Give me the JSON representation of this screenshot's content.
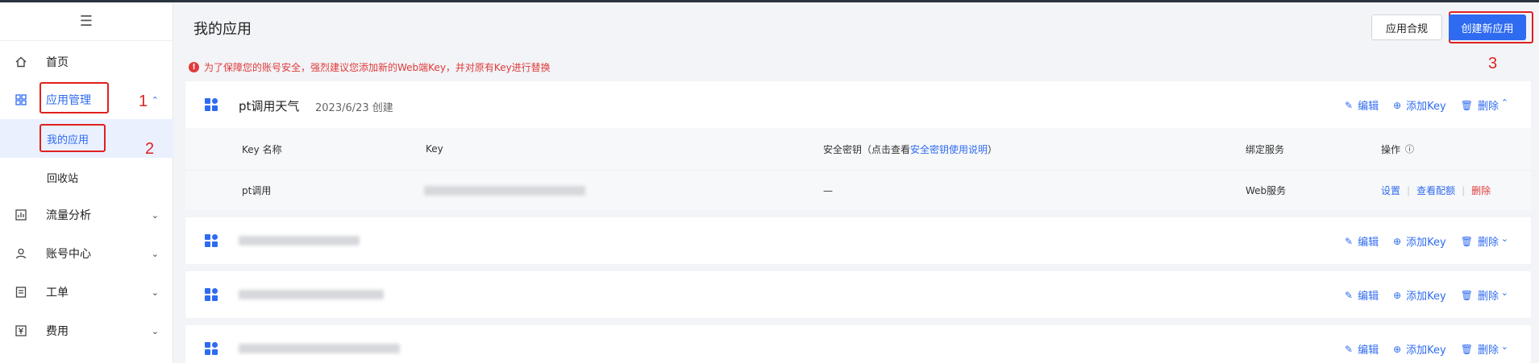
{
  "sidebar": {
    "menu_icon": "hamburger-icon",
    "items": [
      {
        "label": "首页",
        "icon": "home-icon"
      },
      {
        "label": "应用管理",
        "icon": "grid-icon"
      },
      {
        "label": "流量分析",
        "icon": "chart-icon"
      },
      {
        "label": "账号中心",
        "icon": "user-icon"
      },
      {
        "label": "工单",
        "icon": "ticket-icon"
      },
      {
        "label": "费用",
        "icon": "yen-icon"
      }
    ],
    "sub_items": [
      {
        "label": "我的应用"
      },
      {
        "label": "回收站"
      }
    ]
  },
  "annotations": {
    "n1": "1",
    "n2": "2",
    "n3": "3"
  },
  "header": {
    "title": "我的应用",
    "compliance_button": "应用合规",
    "create_button": "创建新应用"
  },
  "warning": {
    "text": "为了保障您的账号安全，强烈建议您添加新的Web端Key，并对原有Key进行替换"
  },
  "actions": {
    "edit": "编辑",
    "add_key": "添加Key",
    "delete": "删除"
  },
  "apps": [
    {
      "name": "pt调用天气",
      "date": "2023/6/23 创建"
    }
  ],
  "table": {
    "headers": {
      "key_name": "Key 名称",
      "key": "Key",
      "secret_prefix": "安全密钥（点击查看",
      "secret_link": "安全密钥使用说明",
      "secret_suffix": "）",
      "service": "绑定服务",
      "ops": "操作"
    },
    "rows": [
      {
        "key_name": "pt调用",
        "secret": "—",
        "service": "Web服务",
        "op_settings": "设置",
        "op_quota": "查看配额",
        "op_delete": "删除"
      }
    ]
  },
  "colors": {
    "primary": "#2f6bf0",
    "danger": "#e03a3a",
    "annotation": "#e02020"
  }
}
